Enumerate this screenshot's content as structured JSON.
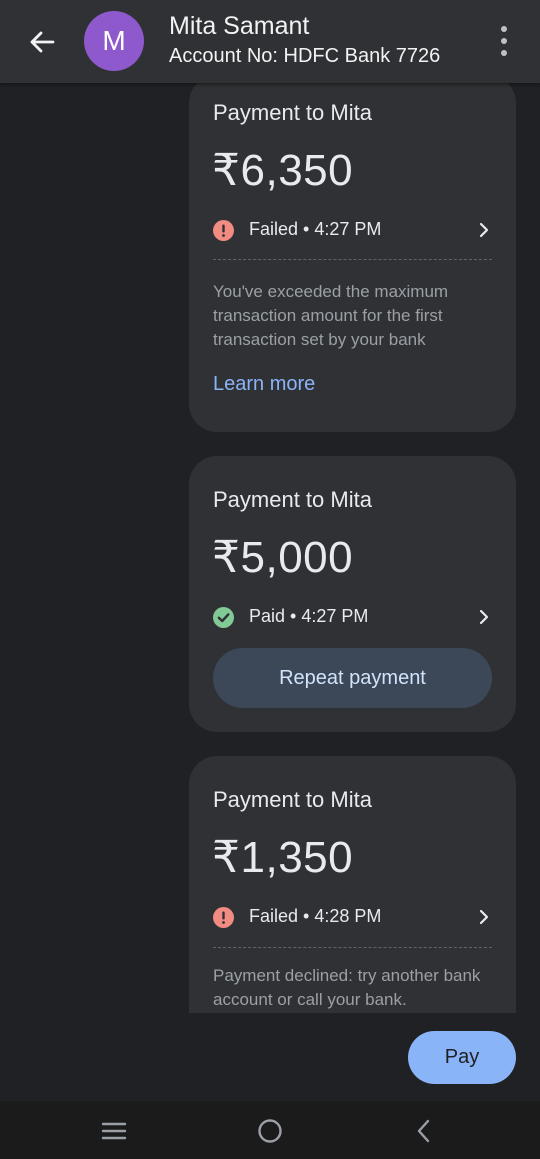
{
  "header": {
    "avatar_letter": "M",
    "contact_name": "Mita Samant",
    "account_no": "Account No: HDFC Bank 7726",
    "back_icon": "arrow-left-icon",
    "more_icon": "more-vertical-icon"
  },
  "transactions": [
    {
      "title": "Payment to Mita",
      "amount": "₹6,350",
      "status": "Failed",
      "time": "4:27 PM",
      "status_text": "Failed • 4:27 PM",
      "note": "You've exceeded the maximum transaction amount for the first transaction set by your bank",
      "link": "Learn more"
    },
    {
      "title": "Payment to Mita",
      "amount": "₹5,000",
      "status": "Paid",
      "time": "4:27 PM",
      "status_text": "Paid • 4:27 PM",
      "action": "Repeat payment"
    },
    {
      "title": "Payment to Mita",
      "amount": "₹1,350",
      "status": "Failed",
      "time": "4:28 PM",
      "status_text": "Failed • 4:28 PM",
      "note": "Payment declined: try another bank account or call your bank."
    }
  ],
  "pay_button": "Pay",
  "colors": {
    "failed": "#f28b82",
    "paid": "#81c995",
    "accent": "#8ab4f8",
    "avatar": "#8e59cc"
  },
  "nav": [
    "menu-icon",
    "home-circle-icon",
    "back-chevron-icon"
  ]
}
